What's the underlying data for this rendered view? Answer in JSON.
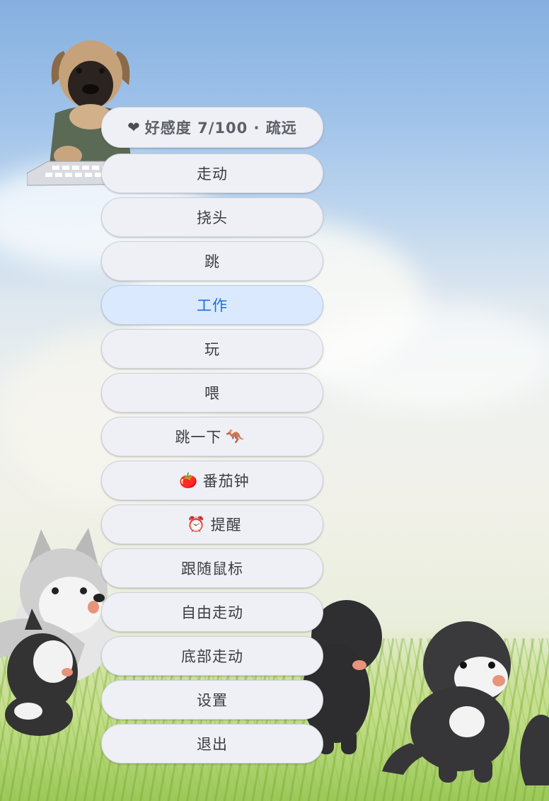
{
  "status": {
    "icon": "heart-icon",
    "label": "好感度 7/100 · 疏远"
  },
  "menu": {
    "items": [
      {
        "label": "走动",
        "active": false
      },
      {
        "label": "挠头",
        "active": false
      },
      {
        "label": "跳",
        "active": false
      },
      {
        "label": "工作",
        "active": true
      },
      {
        "label": "玩",
        "active": false
      },
      {
        "label": "喂",
        "active": false
      },
      {
        "label": "跳一下",
        "suffix": "🦘",
        "active": false
      },
      {
        "prefix": "🍅",
        "label": "番茄钟",
        "active": false
      },
      {
        "prefix": "⏰",
        "label": "提醒",
        "active": false
      },
      {
        "label": "跟随鼠标",
        "active": false
      },
      {
        "label": "自由走动",
        "active": false
      },
      {
        "label": "底部走动",
        "active": false
      },
      {
        "label": "设置",
        "active": false
      },
      {
        "label": "退出",
        "active": false
      }
    ]
  },
  "colors": {
    "menu_bg": "#eef0f5",
    "active_bg": "#dbe9fe",
    "active_text": "#1a6fdc",
    "text": "#3a3d44"
  }
}
